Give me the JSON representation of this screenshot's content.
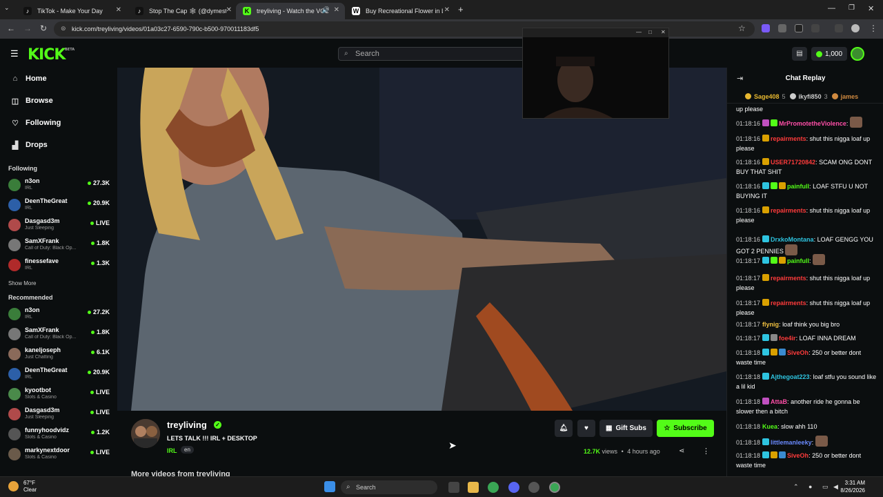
{
  "browser": {
    "tabs": [
      {
        "title": "TikTok - Make Your Day",
        "active": false
      },
      {
        "title": "Stop The Cap 🕸 (@dymestay",
        "active": false
      },
      {
        "title": "treyliving - Watch the VOD",
        "active": true
      },
      {
        "title": "Buy Recreational Flower in Las",
        "active": false
      }
    ],
    "new_tab": "+",
    "url": "kick.com/treyliving/videos/01a03c27-6590-790c-b500-970011183df5"
  },
  "header": {
    "logo": "KICK",
    "logo_badge": "BETA",
    "search_placeholder": "Search",
    "points": "1,000"
  },
  "sidebar": {
    "nav": [
      {
        "label": "Home",
        "icon": "home-icon"
      },
      {
        "label": "Browse",
        "icon": "browse-icon"
      },
      {
        "label": "Following",
        "icon": "heart-icon"
      },
      {
        "label": "Drops",
        "icon": "drops-icon"
      }
    ],
    "following_title": "Following",
    "following": [
      {
        "name": "n3on",
        "category": "IRL",
        "viewers": "27.3K",
        "color": "#3a7d3a"
      },
      {
        "name": "DeenTheGreat",
        "category": "IRL",
        "viewers": "20.9K",
        "color": "#2c5fa8"
      },
      {
        "name": "Dasgasd3m",
        "category": "Just Sleeping",
        "viewers": "LIVE",
        "color": "#b04a4a"
      },
      {
        "name": "SamXFrank",
        "category": "Call of Duty: Black Op...",
        "viewers": "1.8K",
        "color": "#777777"
      },
      {
        "name": "finessefave",
        "category": "IRL",
        "viewers": "1.3K",
        "color": "#b02a2a"
      }
    ],
    "show_more": "Show More",
    "recommended_title": "Recommended",
    "recommended": [
      {
        "name": "n3on",
        "category": "IRL",
        "viewers": "27.2K",
        "color": "#3a7d3a"
      },
      {
        "name": "SamXFrank",
        "category": "Call of Duty: Black Op...",
        "viewers": "1.8K",
        "color": "#777777"
      },
      {
        "name": "kaneljoseph",
        "category": "Just Chatting",
        "viewers": "6.1K",
        "color": "#8a6a5a"
      },
      {
        "name": "DeenTheGreat",
        "category": "IRL",
        "viewers": "20.9K",
        "color": "#2c5fa8"
      },
      {
        "name": "kyootbot",
        "category": "Slots & Casino",
        "viewers": "LIVE",
        "color": "#4a8a4a"
      },
      {
        "name": "Dasgasd3m",
        "category": "Just Sleeping",
        "viewers": "LIVE",
        "color": "#b04a4a"
      },
      {
        "name": "funnyhoodvidz",
        "category": "Slots & Casino",
        "viewers": "1.2K",
        "color": "#555555"
      },
      {
        "name": "markynextdoor",
        "category": "Slots & Casino",
        "viewers": "LIVE",
        "color": "#6a5a4a"
      }
    ]
  },
  "video_info": {
    "channel": "treyliving",
    "title": "LETS TALK !!! IRL + DESKTOP",
    "category": "IRL",
    "language": "en",
    "views": "12.7K",
    "views_label": "views",
    "age": "4 hours ago",
    "gift_subs": "Gift Subs",
    "subscribe": "Subscribe",
    "more_videos": "More videos from treyliving"
  },
  "chat": {
    "title": "Chat Replay",
    "leaders": [
      {
        "name": "Sage408",
        "count": "5",
        "color": "#e8b830"
      },
      {
        "name": "ikyfi850",
        "count": "3",
        "color": "#cccccc"
      },
      {
        "name": "james",
        "count": "",
        "color": "#d08a40"
      }
    ],
    "messages": [
      {
        "time": "",
        "user": "",
        "color": "#ffffff",
        "text": "up please",
        "badges": []
      },
      {
        "time": "01:18:16",
        "user": "MrPromotetheViolence",
        "color": "#ff4fa8",
        "text": "",
        "badges": [
          "#c050c0",
          "#53fc18"
        ],
        "emote": true
      },
      {
        "time": "01:18:16",
        "user": "repairments",
        "color": "#ff3b3b",
        "text": "shut this nigga loaf up please",
        "badges": [
          "#d9a000"
        ]
      },
      {
        "time": "01:18:16",
        "user": "USER71720842",
        "color": "#ff3b3b",
        "text": "SCAM ONG DONT BUY THAT SHIT",
        "badges": [
          "#d9a000"
        ]
      },
      {
        "time": "01:18:16",
        "user": "painfull",
        "color": "#53fc18",
        "text": "LOAF STFU U NOT BUYING IT",
        "badges": [
          "#2ec4e0",
          "#53fc18",
          "#d9a000"
        ]
      },
      {
        "time": "01:18:16",
        "user": "repairments",
        "color": "#ff3b3b",
        "text": "shut this nigga loaf up please",
        "badges": [
          "#d9a000"
        ]
      },
      {
        "time": "01:18:16",
        "user": "DrxkoMontana",
        "color": "#2ec4e0",
        "text": "LOAF GENGG YOU GOT 2 PENNIES",
        "badges": [
          "#2ec4e0"
        ],
        "emote": true
      },
      {
        "time": "01:18:17",
        "user": "painfull",
        "color": "#53fc18",
        "text": "",
        "badges": [
          "#2ec4e0",
          "#53fc18",
          "#d9a000"
        ],
        "emote": true
      },
      {
        "time": "01:18:17",
        "user": "repairments",
        "color": "#ff3b3b",
        "text": "shut this nigga loaf up please",
        "badges": [
          "#d9a000"
        ]
      },
      {
        "time": "01:18:17",
        "user": "repairments",
        "color": "#ff3b3b",
        "text": "shut this nigga loaf up please",
        "badges": [
          "#d9a000"
        ]
      },
      {
        "time": "01:18:17",
        "user": "flynig",
        "color": "#f0c040",
        "text": "loaf think you big bro",
        "badges": []
      },
      {
        "time": "01:18:17",
        "user": "foe4ir",
        "color": "#ff3b3b",
        "text": "LOAF INNA DREAM",
        "badges": [
          "#2ec4e0",
          "#888888"
        ]
      },
      {
        "time": "01:18:18",
        "user": "SiveOh",
        "color": "#ff3b3b",
        "text": "250 or better dont waste time",
        "badges": [
          "#2ec4e0",
          "#d9a000",
          "#3a8ad0"
        ]
      },
      {
        "time": "01:18:18",
        "user": "Ajthegoat223",
        "color": "#2ec4e0",
        "text": "loaf stfu you sound like a lil kid",
        "badges": [
          "#2ec4e0"
        ]
      },
      {
        "time": "01:18:18",
        "user": "AttaB",
        "color": "#ff4fa8",
        "text": "another ride he gonna be slower then a bitch",
        "badges": [
          "#c050c0"
        ]
      },
      {
        "time": "01:18:18",
        "user": "Kuea",
        "color": "#53fc18",
        "text": "slow ahh 110",
        "badges": []
      },
      {
        "time": "01:18:18",
        "user": "littlemanleeky",
        "color": "#6a8aff",
        "text": "",
        "badges": [
          "#2ec4e0"
        ],
        "emote": true
      },
      {
        "time": "01:18:18",
        "user": "SiveOh",
        "color": "#ff3b3b",
        "text": "250 or better dont waste time",
        "badges": [
          "#2ec4e0",
          "#d9a000",
          "#3a8ad0"
        ]
      }
    ]
  },
  "taskbar": {
    "temp": "67°F",
    "weather": "Clear",
    "search": "Search",
    "time": "3:31 AM",
    "date": "8/26/2026"
  }
}
